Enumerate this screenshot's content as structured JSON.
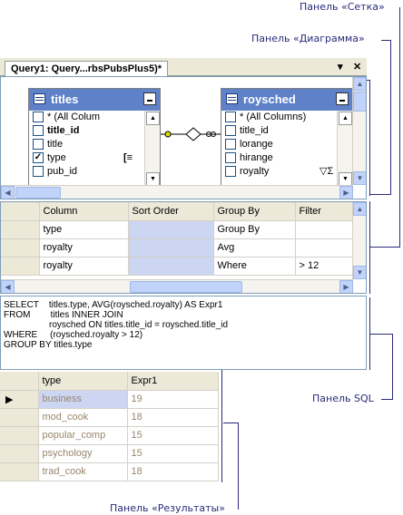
{
  "callouts": {
    "grid_pane": "Панель «Сетка»",
    "diagram_pane": "Панель «Диаграмма»",
    "sql_pane": "Панель SQL",
    "results_pane": "Панель «Результаты»"
  },
  "tab": {
    "title": "Query1: Query...rbsPubsPlus5)*",
    "pin_glyph": "▾",
    "close_glyph": "✕"
  },
  "diagram": {
    "titles_table": {
      "name": "titles",
      "columns": [
        {
          "label": "* (All Colum",
          "checked": false,
          "bold": false
        },
        {
          "label": "title_id",
          "checked": false,
          "bold": true
        },
        {
          "label": "title",
          "checked": false,
          "bold": false
        },
        {
          "label": "type",
          "checked": true,
          "bold": false,
          "groupby": "[≡"
        },
        {
          "label": "pub_id",
          "checked": false,
          "bold": false
        }
      ]
    },
    "roysched_table": {
      "name": "roysched",
      "columns": [
        {
          "label": "* (All Columns)",
          "checked": false
        },
        {
          "label": "title_id",
          "checked": false
        },
        {
          "label": "lorange",
          "checked": false
        },
        {
          "label": "hirange",
          "checked": false
        },
        {
          "label": "royalty",
          "checked": false,
          "filter": "▽Σ"
        }
      ]
    }
  },
  "grid": {
    "headers": [
      "Column",
      "Sort Order",
      "Group By",
      "Filter"
    ],
    "rows": [
      {
        "column": "type",
        "sort": "",
        "group": "Group By",
        "filter": ""
      },
      {
        "column": "royalty",
        "sort": "",
        "group": "Avg",
        "filter": ""
      },
      {
        "column": "royalty",
        "sort": "",
        "group": "Where",
        "filter": "> 12"
      }
    ]
  },
  "sql": {
    "lines": [
      "SELECT    titles.type, AVG(roysched.royalty) AS Expr1",
      "FROM        titles INNER JOIN",
      "                  roysched ON titles.title_id = roysched.title_id",
      "WHERE     (roysched.royalty > 12)",
      "GROUP BY titles.type"
    ]
  },
  "results": {
    "headers": [
      "type",
      "Expr1"
    ],
    "rows": [
      {
        "type": "business",
        "expr1": "19"
      },
      {
        "type": "mod_cook",
        "expr1": "18"
      },
      {
        "type": "popular_comp",
        "expr1": "15"
      },
      {
        "type": "psychology",
        "expr1": "15"
      },
      {
        "type": "trad_cook",
        "expr1": "18"
      }
    ]
  }
}
